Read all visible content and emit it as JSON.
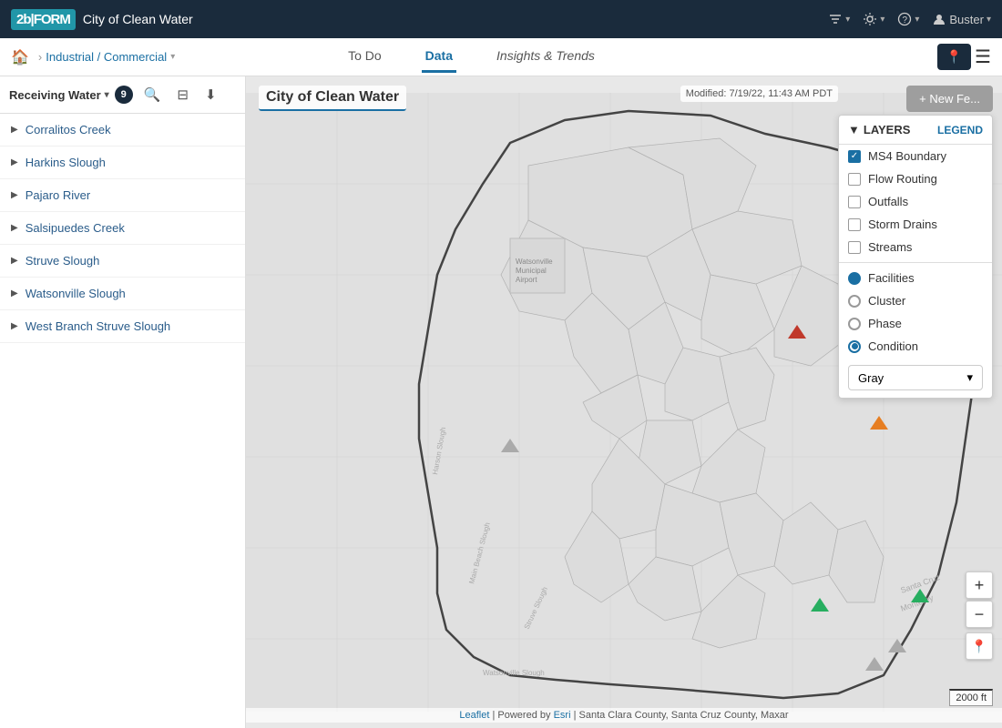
{
  "topnav": {
    "logo": "2b|FORM",
    "title": "City of Clean Water",
    "nav_items": [
      {
        "label": "sort-icon",
        "icon": "⇅"
      },
      {
        "label": "settings-icon",
        "icon": "⚙"
      },
      {
        "label": "help-icon",
        "icon": "?"
      },
      {
        "label": "user-name",
        "text": "Buster"
      }
    ]
  },
  "breadcrumb": {
    "home_label": "🏠",
    "separator": ">",
    "item": "Industrial / Commercial"
  },
  "tabs": [
    {
      "id": "todo",
      "label": "To Do",
      "active": false
    },
    {
      "id": "data",
      "label": "Data",
      "active": true
    },
    {
      "id": "insights",
      "label": "Insights & Trends",
      "active": false,
      "italic": true
    }
  ],
  "sidebar": {
    "toolbar": {
      "receiving_water_label": "Receiving Water",
      "badge_count": "9"
    },
    "items": [
      {
        "label": "Corralitos Creek"
      },
      {
        "label": "Harkins Slough"
      },
      {
        "label": "Pajaro River"
      },
      {
        "label": "Salsipuedes Creek"
      },
      {
        "label": "Struve Slough"
      },
      {
        "label": "Watsonville Slough"
      },
      {
        "label": "West Branch Struve Slough"
      }
    ]
  },
  "map": {
    "title": "City of Clean Water",
    "modified": "Modified: 7/19/22, 11:43 AM PDT",
    "add_feature_label": "+ New Fe..."
  },
  "layers_panel": {
    "title": "LAYERS",
    "legend_label": "LEGEND",
    "layers": [
      {
        "id": "ms4",
        "label": "MS4 Boundary",
        "checked": true
      },
      {
        "id": "flow",
        "label": "Flow Routing",
        "checked": false
      },
      {
        "id": "outfalls",
        "label": "Outfalls",
        "checked": false
      },
      {
        "id": "storm",
        "label": "Storm Drains",
        "checked": false
      },
      {
        "id": "streams",
        "label": "Streams",
        "checked": false
      }
    ],
    "facilities_label": "Facilities",
    "radios": [
      {
        "id": "cluster",
        "label": "Cluster",
        "selected": false
      },
      {
        "id": "phase",
        "label": "Phase",
        "selected": false
      },
      {
        "id": "condition",
        "label": "Condition",
        "selected": true
      }
    ],
    "basemap": "Gray"
  },
  "zoom": {
    "in_label": "+",
    "out_label": "−"
  },
  "scale": {
    "label": "2000 ft"
  },
  "attribution": {
    "leaflet": "Leaflet",
    "powered": "| Powered by",
    "esri": "Esri",
    "credits": "| Santa Clara County, Santa Cruz County, Maxar"
  }
}
